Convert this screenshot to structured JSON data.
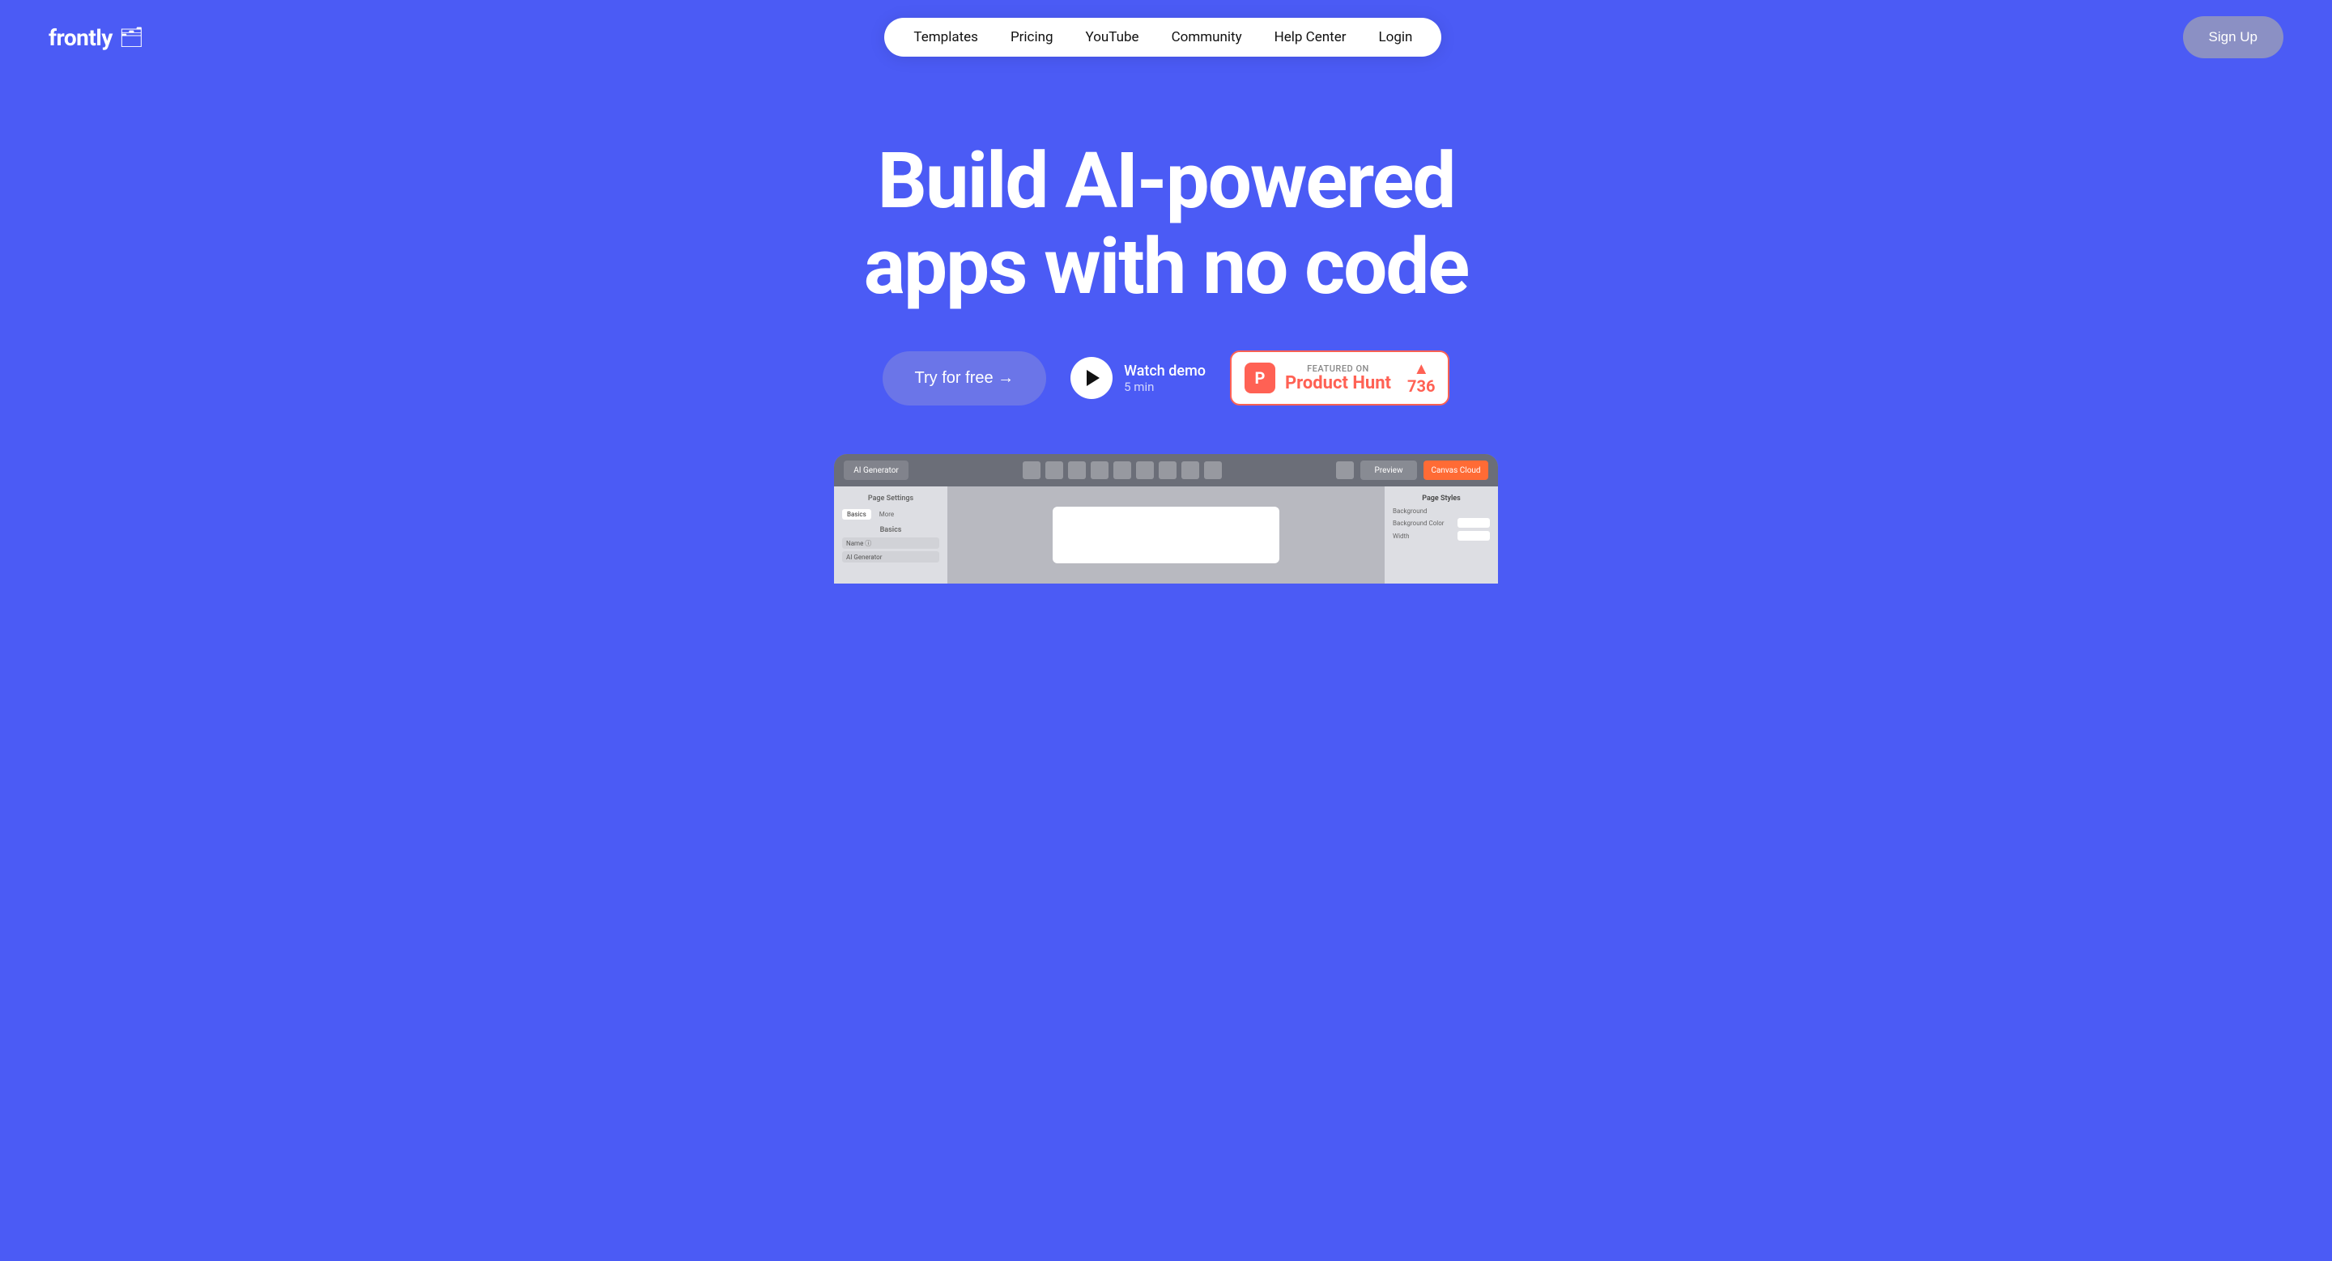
{
  "brand": {
    "name": "frontly",
    "icon": "🗂"
  },
  "nav": {
    "items": [
      {
        "label": "Templates",
        "id": "templates"
      },
      {
        "label": "Pricing",
        "id": "pricing"
      },
      {
        "label": "YouTube",
        "id": "youtube"
      },
      {
        "label": "Community",
        "id": "community"
      },
      {
        "label": "Help Center",
        "id": "help-center"
      },
      {
        "label": "Login",
        "id": "login"
      }
    ],
    "signup_label": "Sign Up"
  },
  "hero": {
    "title_line1": "Build AI-powered",
    "title_line2": "apps with no code",
    "try_free_label": "Try for free →",
    "watch_demo_label": "Watch demo",
    "watch_demo_duration": "5 min"
  },
  "product_hunt": {
    "featured_on": "FEATURED ON",
    "name": "Product Hunt",
    "votes": "736",
    "icon": "P"
  },
  "app_preview": {
    "toolbar_label": "AI Generator",
    "preview_label": "Preview",
    "action_label": "Canvas Cloud",
    "left_sidebar": {
      "title": "Page Settings",
      "tabs": [
        "Basics",
        "More"
      ],
      "section_title": "Basics",
      "items": [
        "Name ⓘ",
        "AI Generator"
      ]
    },
    "right_sidebar": {
      "title": "Page Styles",
      "background_label": "Background",
      "background_color_label": "Background Color",
      "width_label": "Width"
    }
  },
  "colors": {
    "background": "#4B5BF5",
    "nav_bg": "#FFFFFF",
    "signup_bg": "#8B90C4",
    "try_btn_bg": "#6B75E8",
    "product_hunt_red": "#FF6154",
    "app_preview_bg": "#9B9EA8"
  }
}
